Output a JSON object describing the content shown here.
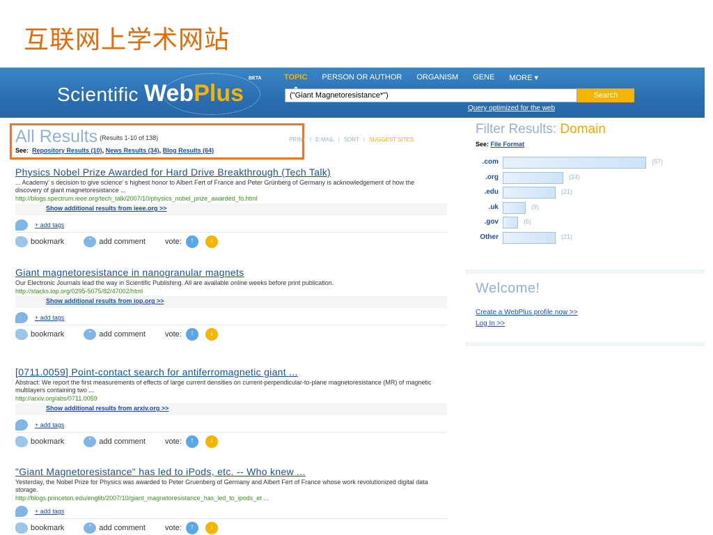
{
  "slide": {
    "title": "互联网上学术网站"
  },
  "header": {
    "logo": {
      "scientific": "Scientific",
      "web": "Web",
      "plus": "Plus",
      "beta": "BETA"
    },
    "nav": [
      "TOPIC",
      "PERSON OR AUTHOR",
      "ORGANISM",
      "GENE",
      "MORE"
    ],
    "search_value": "(\"Giant Magnetoresistance*\")",
    "search_button": "Search",
    "query_note": "Query optimized for the web"
  },
  "results_header": {
    "title": "All Results",
    "count": "(Results 1-10 of 138)",
    "see_label": "See:",
    "see_links": [
      "Repository Results (10)",
      "News Results (34)",
      "Blog Results (64)"
    ],
    "tools": [
      "PRINT",
      "E-MAIL",
      "SORT",
      "SUGGEST SITES"
    ]
  },
  "result_actions": {
    "add_tags": "+ add tags",
    "bookmark": "bookmark",
    "comment": "add comment",
    "vote": "vote:"
  },
  "results": [
    {
      "title": "Physics Nobel Prize Awarded for Hard Drive Breakthrough (Tech Talk)",
      "snippet": "... Academy’ s decision to give science’ s highest honor to Albert Fert of France and Peter Grünberg of Germany is acknowledgement of how the discovery of giant magnetoresistance ...",
      "url": "http://blogs.spectrum.ieee.org/tech_talk/2007/10/physics_nobel_prize_awarded_fo.html",
      "more": "Show additional results from ieee.org >>"
    },
    {
      "title": "Giant magnetoresistance in nanogranular magnets",
      "snippet": "Our Electronic Journals lead the way in Scientific Publishing. All are available online weeks before print publication.",
      "url": "http://stacks.iop.org/0295-5075/82/47002/html",
      "more": "Show additional results from iop.org >>"
    },
    {
      "title": "[0711.0059] Point-contact search for antiferromagnetic giant ...",
      "snippet": "Abstract: We report the first measurements of effects of large current densities on current-perpendicular-to-plane magnetoresistance (MR) of magnetic multilayers containing two ...",
      "url": "http://arxiv.org/abs/0711.0059",
      "more": "Show additional results from arxiv.org >>"
    },
    {
      "title": "\"Giant Magnetoresistance\" has led to iPods, etc. -- Who knew ...",
      "snippet": "Yesterday, the Nobel Prize for Physics was awarded to Peter Gruenberg of Germany and Albert Fert of France whose work revolutionized digital data storage.",
      "url": "http://blogs.princeton.edu/englib/2007/10/giant_magnetoresistance_has_led_to_ipods_et ...",
      "more": ""
    }
  ],
  "filter": {
    "title": "Filter Results:",
    "title_accent": "Domain",
    "see_label": "See:",
    "see_link": "File Format",
    "domains": [
      {
        "label": ".com",
        "count": 57,
        "count_text": "(57)"
      },
      {
        "label": ".org",
        "count": 24,
        "count_text": "(24)"
      },
      {
        "label": ".edu",
        "count": 21,
        "count_text": "(21)"
      },
      {
        "label": ".uk",
        "count": 9,
        "count_text": "(9)"
      },
      {
        "label": ".gov",
        "count": 6,
        "count_text": "(6)"
      },
      {
        "label": "Other",
        "count": 21,
        "count_text": "(21)"
      }
    ]
  },
  "welcome": {
    "title": "Welcome!",
    "links": [
      "Create a WebPlus profile now >>",
      "Log In >>"
    ]
  },
  "colors": {
    "header": "#2a6fb3",
    "accent": "#f5b400",
    "link": "#1c4f9c",
    "url": "#3a8f1a",
    "highlight": "#e8772e",
    "slide_title": "#e06c0c"
  }
}
